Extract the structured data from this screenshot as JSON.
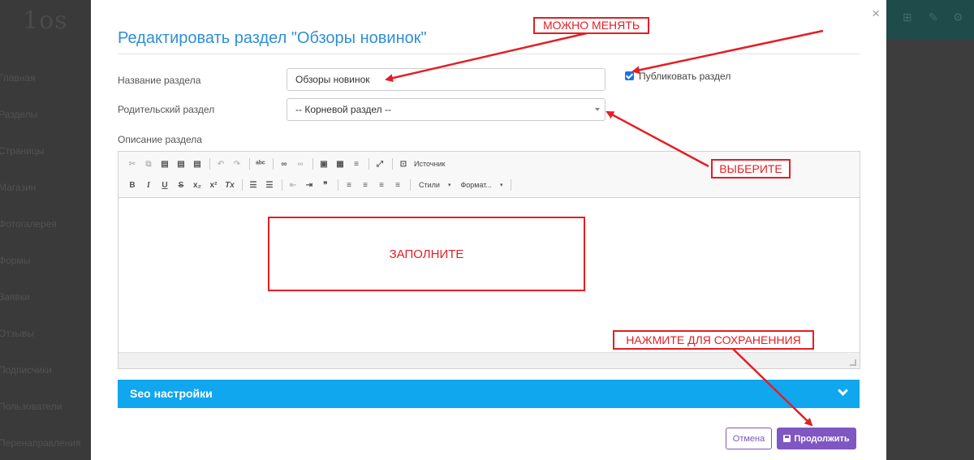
{
  "background": {
    "logo": "1os",
    "menu": [
      "Главная",
      "Разделы",
      "Страницы",
      "Магазин",
      "Фотогалерея",
      "Формы",
      "Заявки",
      "Отзывы",
      "Подписчики",
      "Пользователи",
      "Перенаправления"
    ]
  },
  "modal": {
    "title": "Редактировать раздел \"Обзоры новинок\"",
    "close": "×",
    "fields": {
      "name_label": "Название раздела",
      "name_value": "Обзоры новинок",
      "parent_label": "Родительский раздел",
      "parent_value": "-- Корневой раздел --",
      "publish_label": "Публиковать раздел",
      "publish_checked": true,
      "description_label": "Описание раздела"
    },
    "editor": {
      "source_label": "Источник",
      "styles_label": "Стили",
      "format_label": "Формат..."
    },
    "seo": {
      "label": "Seo настройки"
    },
    "buttons": {
      "cancel": "Отмена",
      "continue": "Продолжить"
    }
  },
  "annotations": {
    "can_change": "МОЖНО МЕНЯТЬ",
    "choose": "ВЫБЕРИТЕ",
    "fill": "ЗАПОЛНИТЕ",
    "press_to_save": "НАЖМИТЕ ДЛЯ СОХРАНЕННИЯ"
  },
  "colors": {
    "title": "#2f8fd5",
    "seo_bar": "#10a7ef",
    "primary_button": "#7e57c2",
    "annotation": "#e31e24"
  }
}
